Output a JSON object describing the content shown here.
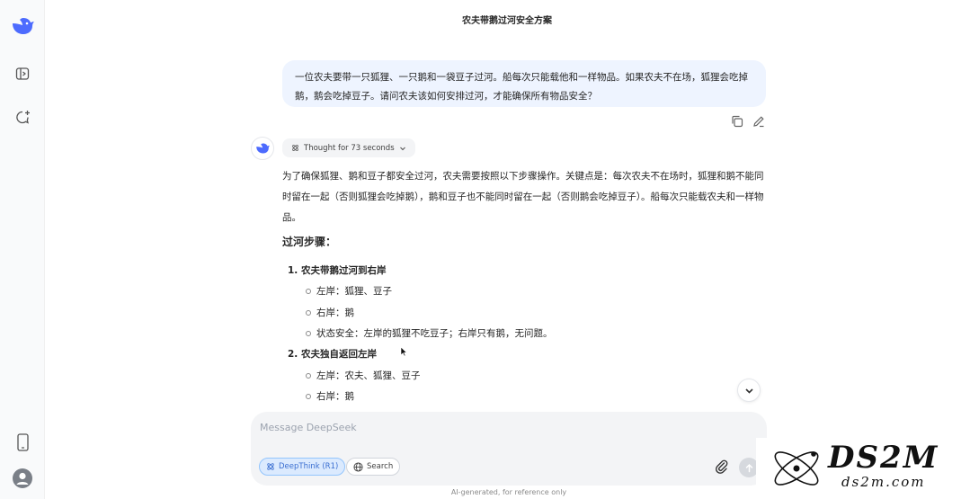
{
  "header": {
    "title": "农夫带鹅过河安全方案"
  },
  "sidebar": {
    "icons": [
      "deepseek-logo",
      "open-sidebar-icon",
      "new-chat-icon",
      "mobile-app-icon",
      "user-avatar"
    ]
  },
  "user_message": "一位农夫要带一只狐狸、一只鹅和一袋豆子过河。船每次只能载他和一样物品。如果农夫不在场，狐狸会吃掉鹅，鹅会吃掉豆子。请问农夫该如何安排过河，才能确保所有物品安全？",
  "thought_label": "Thought for 73 seconds",
  "answer": {
    "intro": "为了确保狐狸、鹅和豆子都安全过河，农夫需要按照以下步骤操作。关键点是：每次农夫不在场时，狐狸和鹅不能同时留在一起（否则狐狸会吃掉鹅），鹅和豆子也不能同时留在一起（否则鹅会吃掉豆子）。船每次只能载农夫和一样物品。",
    "heading": "过河步骤：",
    "step1": {
      "title": "1.  农夫带鹅过河到右岸",
      "items": [
        "左岸：狐狸、豆子",
        "右岸：鹅",
        "状态安全：左岸的狐狸不吃豆子；右岸只有鹅，无问题。"
      ]
    },
    "step2": {
      "title": "2.  农夫独自返回左岸",
      "items": [
        "左岸：农夫、狐狸、豆子",
        "右岸：鹅"
      ]
    }
  },
  "composer": {
    "placeholder": "Message DeepSeek",
    "deepthink_label": "DeepThink (R1)",
    "search_label": "Search"
  },
  "footer": "AI-generated, for reference only",
  "watermark": {
    "big": "DS2M",
    "small": "ds2m.com"
  },
  "colors": {
    "accent": "#4d6bfe",
    "user_bubble": "#eef4ff",
    "composer_bg": "#f3f4f6"
  }
}
